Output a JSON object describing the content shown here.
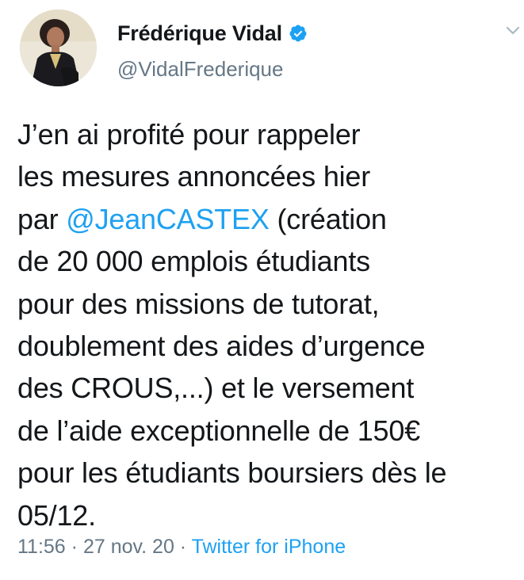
{
  "author": {
    "display_name": "Frédérique Vidal",
    "handle": "@VidalFrederique",
    "verified": true
  },
  "tweet": {
    "lines": [
      {
        "text": "J’en ai profité pour rappeler"
      },
      {
        "text": "les mesures annoncées hier"
      },
      {
        "prefix": "par ",
        "mention": "@JeanCASTEX",
        "suffix": " (création"
      },
      {
        "text": "de 20 000 emplois étudiants"
      },
      {
        "text": "pour des missions de tutorat,"
      },
      {
        "text": "doublement des aides d’urgence"
      },
      {
        "text": "des CROUS,...) et le versement"
      },
      {
        "text": "de l’aide exceptionnelle de 150€"
      },
      {
        "text": "pour les étudiants boursiers dès le"
      },
      {
        "text": "05/12."
      }
    ]
  },
  "meta": {
    "time": "11:56",
    "separator_1": " · ",
    "date": "27 nov. 20",
    "separator_2": " · ",
    "source": "Twitter for iPhone"
  },
  "icons": {
    "verified": "verified-badge-icon",
    "menu": "chevron-down-icon"
  },
  "colors": {
    "accent": "#1da1f2",
    "text": "#14171a",
    "secondary": "#657786"
  }
}
